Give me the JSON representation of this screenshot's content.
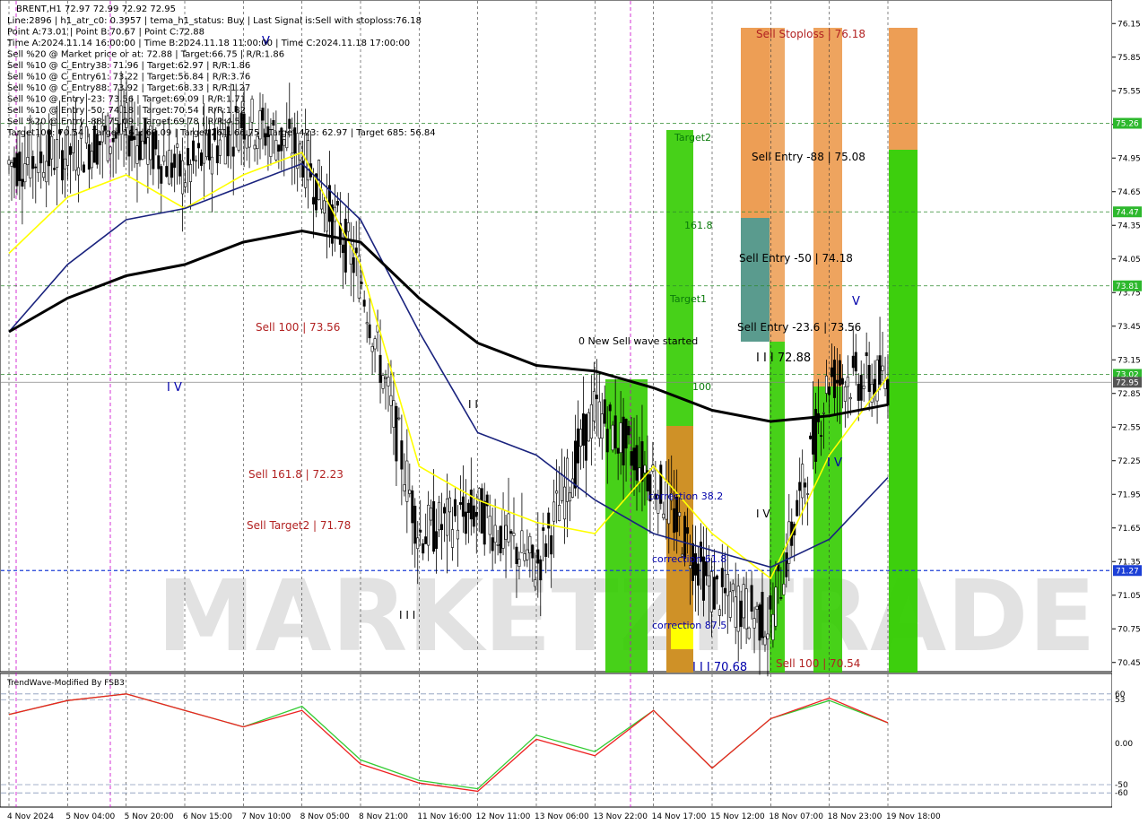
{
  "header": {
    "symbol_line": "BRENT,H1  72.97 72.99 72.92 72.95",
    "info_lines": [
      "Line:2896 | h1_atr_c0: 0.3957 | tema_h1_status: Buy | Last Signal is:Sell with stoploss:76.18",
      "Point A:73.01 | Point B:70.67 | Point C:72.88",
      "Time A:2024.11.14 16:00:00 | Time B:2024.11.18 11:00:00 | Time C:2024.11.18 17:00:00",
      "Sell %20 @ Market price or at: 72.88 | Target:66.75 | R/R:1.86",
      "Sell %10 @ C_Entry38: 71.96 | Target:62.97 | R/R:1.86",
      "Sell %10 @ C_Entry61: 73.22 | Target:56.84 | R/R:3.76",
      "Sell %10 @ C_Entry88: 73.92 | Target:68.33 | R/R:1.27",
      "Sell %10 @ Entry -23: 73.56 | Target:69.09 | R/R:1.71",
      "Sell %10 @ Entry -50: 74.18 | Target:70.54 | R/R:1.82",
      "Sell %20 @ Entry -88: 75.09 | Target:69.78 | R/R:4.53",
      "Target100: 70.54 | Target 161: 69.09 | Target 261: 66.75 | Target 423: 62.97 | Target 685: 56.84"
    ]
  },
  "chart_labels": {
    "sell_stoploss": "Sell Stoploss | 76.18",
    "sell_entry_88": "Sell Entry -88 | 75.08",
    "sell_entry_50": "Sell Entry -50 | 74.18",
    "sell_entry_23": "Sell Entry -23.6 | 73.56",
    "sell_100_top": "Sell 100 | 73.56",
    "sell_1618": "Sell 161.8 | 72.23",
    "sell_target2": "Sell Target2 | 71.78",
    "sell_100_bottom": "Sell 100 | 70.54",
    "target2": "Target2",
    "fib_1618": "161.8",
    "target1": "Target1",
    "fib_100": "100",
    "new_wave": "0 New Sell wave started",
    "point_c_label": "I I I 72.88",
    "point_b_label": "I I I 70.68",
    "correction_382": "correction 38.2",
    "correction_618": "correction 61.8",
    "correction_875": "correction 87.5",
    "wave_iv_left": "I V",
    "wave_iv_right": "I V",
    "wave_v_top_left": "V",
    "wave_v_right": "V",
    "wave_iii": "I I I",
    "wave_iv_mid": "I V",
    "wave_ii_right": "I I",
    "wave_i": "I",
    "watermark": "MARKETZITRADE"
  },
  "price_axis": {
    "ticks": [
      "76.15",
      "75.85",
      "75.55",
      "75.25",
      "74.95",
      "74.65",
      "74.35",
      "74.05",
      "73.75",
      "73.45",
      "73.15",
      "72.85",
      "72.55",
      "72.25",
      "71.95",
      "71.65",
      "71.35",
      "71.05",
      "70.75",
      "70.45"
    ],
    "tags": [
      {
        "text": "75.26",
        "color": "#2db82d"
      },
      {
        "text": "74.47",
        "color": "#2db82d"
      },
      {
        "text": "73.81",
        "color": "#2db82d"
      },
      {
        "text": "73.02",
        "color": "#2db82d"
      },
      {
        "text": "72.95",
        "color": "#555555"
      },
      {
        "text": "71.27",
        "color": "#1c3fd6"
      }
    ]
  },
  "time_axis": {
    "labels": [
      "4 Nov 2024",
      "5 Nov 04:00",
      "5 Nov 20:00",
      "6 Nov 15:00",
      "7 Nov 10:00",
      "8 Nov 05:00",
      "8 Nov 21:00",
      "11 Nov 16:00",
      "12 Nov 11:00",
      "13 Nov 06:00",
      "13 Nov 22:00",
      "14 Nov 17:00",
      "15 Nov 12:00",
      "18 Nov 07:00",
      "18 Nov 23:00",
      "19 Nov 18:00"
    ]
  },
  "oscillator": {
    "title": "TrendWave-Modified By FSB3",
    "ticks": [
      "60",
      "53",
      "0.00",
      "-50",
      "-60"
    ]
  },
  "chart_data": {
    "type": "line",
    "title": "BRENT,H1",
    "ylim": [
      70.4,
      76.2
    ],
    "x": [
      "4 Nov 2024",
      "5 Nov 04:00",
      "5 Nov 20:00",
      "6 Nov 15:00",
      "7 Nov 10:00",
      "8 Nov 05:00",
      "8 Nov 21:00",
      "11 Nov 16:00",
      "12 Nov 11:00",
      "13 Nov 06:00",
      "13 Nov 22:00",
      "14 Nov 17:00",
      "15 Nov 12:00",
      "18 Nov 07:00",
      "18 Nov 23:00",
      "19 Nov 18:00"
    ],
    "series": [
      {
        "values": [
          74.9,
          75.0,
          75.2,
          74.8,
          75.3,
          75.0,
          73.9,
          71.6,
          71.8,
          71.3,
          72.7,
          72.1,
          71.1,
          70.8,
          73.0,
          72.95
        ]
      },
      {
        "values": [
          74.1,
          74.6,
          74.8,
          74.5,
          74.8,
          75.0,
          74.0,
          72.2,
          71.9,
          71.7,
          71.6,
          72.2,
          71.6,
          71.2,
          72.3,
          73.0
        ]
      },
      {
        "values": [
          73.4,
          74.0,
          74.4,
          74.5,
          74.7,
          74.9,
          74.4,
          73.4,
          72.5,
          72.3,
          71.9,
          71.6,
          71.45,
          71.3,
          71.55,
          72.1
        ]
      },
      {
        "values": [
          73.4,
          73.7,
          73.9,
          74.0,
          74.2,
          74.3,
          74.2,
          73.7,
          73.3,
          73.1,
          73.05,
          72.9,
          72.7,
          72.6,
          72.65,
          72.75
        ]
      }
    ],
    "horizontal_levels": [
      75.26,
      74.47,
      73.81,
      73.02,
      72.95,
      71.27
    ],
    "oscillator": {
      "ylim": [
        -75,
        75
      ],
      "series": [
        {
          "values": [
            35,
            52,
            60,
            40,
            20,
            45,
            -20,
            -45,
            -55,
            10,
            -10,
            40,
            -30,
            30,
            52,
            25
          ]
        },
        {
          "values": [
            35,
            52,
            60,
            40,
            20,
            40,
            -25,
            -48,
            -58,
            5,
            -15,
            40,
            -30,
            30,
            55,
            25
          ]
        }
      ]
    },
    "colors": {
      "price": "#000000",
      "tema": "#ffff00",
      "ma_fast": "#1a237e",
      "ma_slow": "#000000",
      "green_zone": "#33cc00",
      "orange_zone": "#e8862a",
      "teal_zone": "#3d8a7a",
      "osc_green": "#33cc33",
      "osc_red": "#ee2222"
    }
  }
}
